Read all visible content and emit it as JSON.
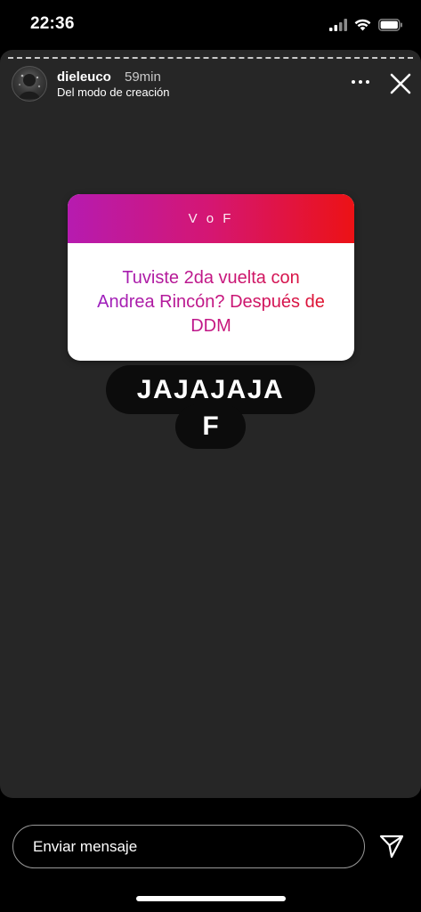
{
  "status_bar": {
    "time": "22:36",
    "icons": [
      "cellular-signal-icon",
      "wifi-icon",
      "battery-icon"
    ]
  },
  "story": {
    "username": "dieleuco",
    "time_ago": "59min",
    "subtitle": "Del modo de creación",
    "progress_segments": "dashed",
    "icons": [
      "more-options-icon",
      "close-icon"
    ]
  },
  "sticker": {
    "header": "V o F",
    "question": "Tuviste 2da vuelta con Andrea Rincón? Después de DDM",
    "gradient_colors": [
      "#b61bb0",
      "#d51672",
      "#ec1215"
    ]
  },
  "answer": {
    "line1": "JAJAJAJA",
    "line2": "F"
  },
  "bottom_bar": {
    "message_placeholder": "Enviar mensaje",
    "send_icon": "send-icon"
  }
}
